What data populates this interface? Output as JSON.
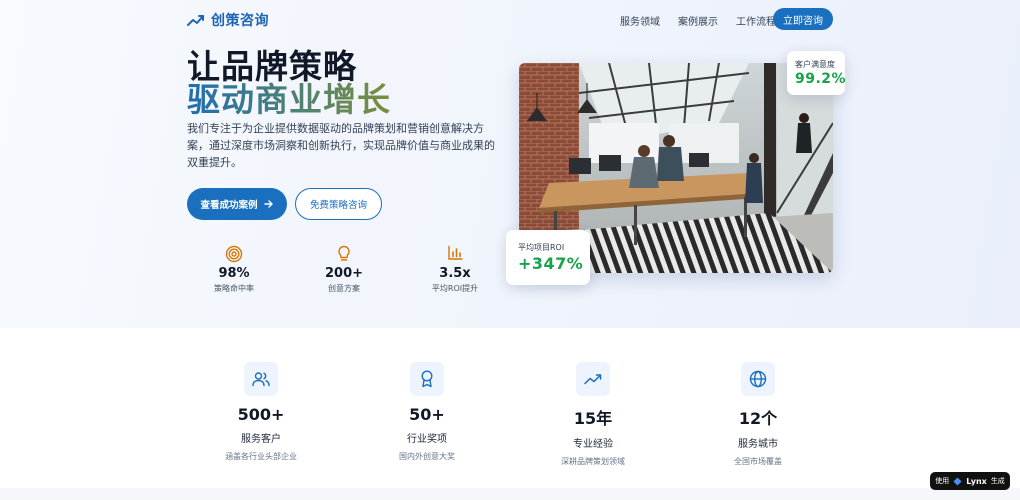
{
  "brand": {
    "name": "创策咨询",
    "logo_icon": "trending-up-icon",
    "color": "#1e64b4"
  },
  "nav": {
    "links": [
      "服务领域",
      "案例展示",
      "工作流程"
    ],
    "cta": "立即咨询"
  },
  "hero": {
    "title_line1": "让品牌策略",
    "title_line2": "驱动商业增长",
    "description": "我们专注于为企业提供数据驱动的品牌策划和营销创意解决方案，通过深度市场洞察和创新执行，实现品牌价值与商业成果的双重提升。",
    "primary_button": "查看成功案例",
    "primary_button_icon": "arrow-right-icon",
    "secondary_button": "免费策略咨询",
    "stats": [
      {
        "icon": "target-icon",
        "value": "98%",
        "label": "策略命中率"
      },
      {
        "icon": "lightbulb-icon",
        "value": "200+",
        "label": "创意方案"
      },
      {
        "icon": "bar-chart-icon",
        "value": "3.5x",
        "label": "平均ROI提升"
      }
    ],
    "card_satisfaction": {
      "label": "客户满意度",
      "value": "99.2%"
    },
    "card_roi": {
      "label": "平均项目ROI",
      "value": "+347%"
    }
  },
  "features": [
    {
      "icon": "users-icon",
      "value": "500+",
      "label": "服务客户",
      "sub": "涵盖各行业头部企业"
    },
    {
      "icon": "award-icon",
      "value": "50+",
      "label": "行业奖项",
      "sub": "国内外创意大奖"
    },
    {
      "icon": "trending-up-icon",
      "value": "15年",
      "label": "专业经验",
      "sub": "深耕品牌策划领域"
    },
    {
      "icon": "globe-icon",
      "value": "12个",
      "label": "服务城市",
      "sub": "全国市场覆盖"
    }
  ],
  "made_with": {
    "prefix": "使用",
    "name": "Lynx",
    "suffix": "生成"
  },
  "colors": {
    "accent": "#1a6fbf",
    "success": "#16a34a"
  }
}
